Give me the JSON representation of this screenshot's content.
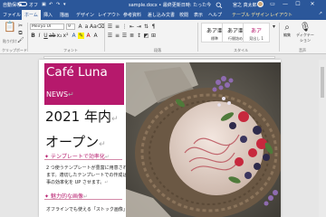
{
  "titlebar": {
    "autosave_label": "自動保存",
    "autosave_state": "オフ",
    "doc_title": "sample.docx • 最終更新日時: たった今",
    "search_icon": "search-icon",
    "user_name": "宮之 真太郎",
    "window_controls": [
      "—",
      "☐",
      "✕"
    ]
  },
  "tabs": {
    "items": [
      "ファイル",
      "ホーム",
      "挿入",
      "描画",
      "デザイン",
      "レイアウト",
      "参考資料",
      "差し込み文書",
      "校閲",
      "表示",
      "ヘルプ"
    ],
    "active_index": 1,
    "context_tabs": [
      "テーブル デザイン",
      "レイアウト"
    ],
    "share_label": "↗"
  },
  "ribbon": {
    "paste_label": "貼り付け",
    "clipboard_label": "クリップボード",
    "font_name": "Meiryo UI",
    "font_size": "9",
    "font_group_label": "フォント",
    "paragraph_group_label": "段落",
    "styles_group_label": "スタイル",
    "styles": [
      {
        "sample": "あア亜",
        "name": "標準"
      },
      {
        "sample": "あア亜",
        "name": "行間詰め"
      },
      {
        "sample": "あア",
        "name": "見出し 1"
      }
    ],
    "edit_label": "編集",
    "dictate_label": "ディクテーション",
    "voice_group_label": "音声"
  },
  "document": {
    "banner_title": "Café Luna",
    "banner_subtitle": "NEWS",
    "headline_1": "2021 年内",
    "headline_2": "オープン",
    "section_1_heading": "テンプレートで効率化",
    "section_1_body": [
      "2 つ使うテンプレートが豊富に用意されてい",
      "ます。適切したテンプレートでの作成は仕",
      "事の効率化を UP させます。"
    ],
    "section_2_heading": "魅力的な画像",
    "section_2_body": [
      "オフラインでも使える「ストック画像」のほ"
    ],
    "paragraph_mark": "↵",
    "accent_color": "#b6196c"
  }
}
